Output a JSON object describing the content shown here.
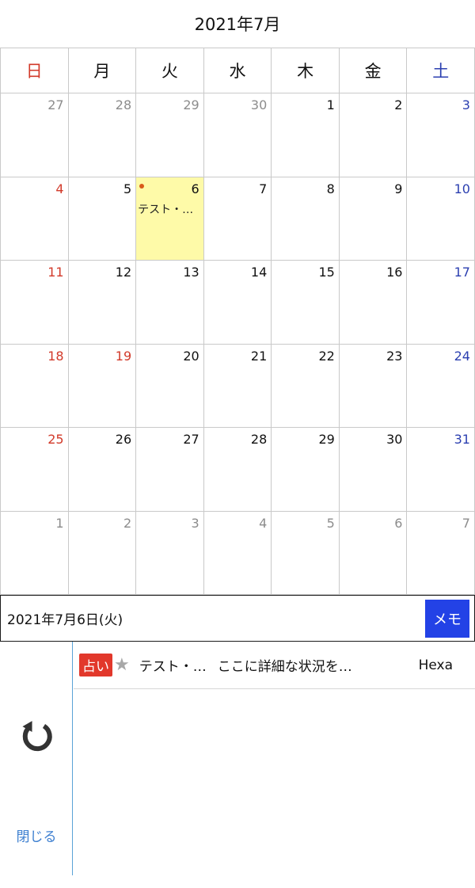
{
  "header": {
    "month_title": "2021年7月"
  },
  "weekdays": [
    "日",
    "月",
    "火",
    "水",
    "木",
    "金",
    "土"
  ],
  "weeks": [
    [
      {
        "n": "27",
        "o": true
      },
      {
        "n": "28",
        "o": true
      },
      {
        "n": "29",
        "o": true
      },
      {
        "n": "30",
        "o": true
      },
      {
        "n": "1"
      },
      {
        "n": "2"
      },
      {
        "n": "3"
      }
    ],
    [
      {
        "n": "4"
      },
      {
        "n": "5"
      },
      {
        "n": "6",
        "sel": true,
        "ev": "テスト・…"
      },
      {
        "n": "7"
      },
      {
        "n": "8"
      },
      {
        "n": "9"
      },
      {
        "n": "10"
      }
    ],
    [
      {
        "n": "11"
      },
      {
        "n": "12"
      },
      {
        "n": "13"
      },
      {
        "n": "14"
      },
      {
        "n": "15"
      },
      {
        "n": "16"
      },
      {
        "n": "17"
      }
    ],
    [
      {
        "n": "18"
      },
      {
        "n": "19",
        "hol": true
      },
      {
        "n": "20"
      },
      {
        "n": "21"
      },
      {
        "n": "22"
      },
      {
        "n": "23"
      },
      {
        "n": "24"
      }
    ],
    [
      {
        "n": "25"
      },
      {
        "n": "26"
      },
      {
        "n": "27"
      },
      {
        "n": "28"
      },
      {
        "n": "29"
      },
      {
        "n": "30"
      },
      {
        "n": "31"
      }
    ],
    [
      {
        "n": "1",
        "o": true
      },
      {
        "n": "2",
        "o": true
      },
      {
        "n": "3",
        "o": true
      },
      {
        "n": "4",
        "o": true
      },
      {
        "n": "5",
        "o": true
      },
      {
        "n": "6",
        "o": true
      },
      {
        "n": "7",
        "o": true
      }
    ]
  ],
  "selected_date": {
    "label": "2021年7月6日(火)",
    "memo_label": "メモ"
  },
  "side": {
    "refresh_icon": "refresh-icon",
    "close_label": "閉じる"
  },
  "entries": [
    {
      "badge": "占い",
      "star_icon": "star-icon",
      "title": "テスト・…",
      "detail": "ここに詳細な状況を…",
      "right": "Hexa"
    }
  ],
  "colors": {
    "sunday": "#d23a2a",
    "saturday": "#2b3fb0",
    "selected_bg": "#fefaa8",
    "memo_button": "#2342e6",
    "badge": "#e2382b",
    "link": "#3d7fd0"
  }
}
